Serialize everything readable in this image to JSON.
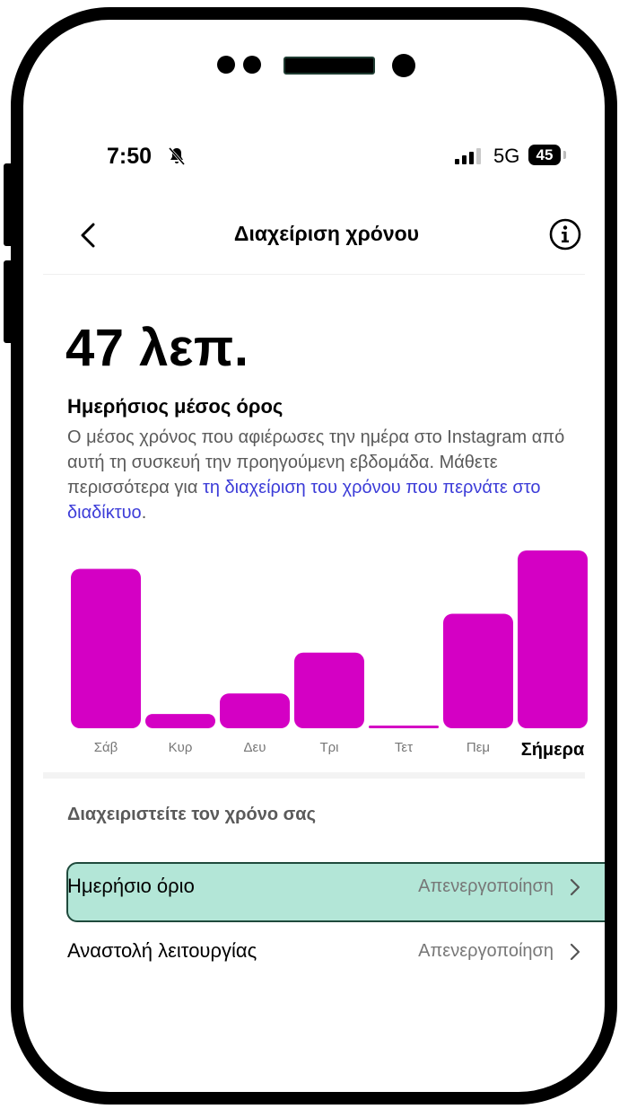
{
  "status_bar": {
    "time": "7:50",
    "network": "5G",
    "battery": "45",
    "bell_icon": "bell-slash-icon",
    "signal_icon": "cellular-signal-icon"
  },
  "header": {
    "title": "Διαχείριση χρόνου",
    "back_icon": "back-chevron-icon",
    "info_icon": "info-circle-icon"
  },
  "summary": {
    "value": "47 λεπ.",
    "label": "Ημερήσιος μέσος όρος",
    "description_text": "Ο μέσος χρόνος που αφιέρωσες την ημέρα στο Instagram από αυτή τη συσκευή την προηγούμενη εβδομάδα. Μάθετε περισσότερα για ",
    "description_link": "τη διαχείριση του χρόνου που περνάτε στο διαδίκτυο",
    "description_end": "."
  },
  "chart_data": {
    "type": "bar",
    "categories": [
      "Σάβ",
      "Κυρ",
      "Δευ",
      "Τρι",
      "Τετ",
      "Πεμ",
      "Σήμερα"
    ],
    "values": [
      78,
      7,
      17,
      37,
      1,
      56,
      87
    ],
    "highlight_category": "Σήμερα",
    "color": "#d400c4",
    "ylim": [
      0,
      87
    ]
  },
  "manage": {
    "section_title": "Διαχειριστείτε τον χρόνο σας",
    "rows": [
      {
        "label": "Ημερήσιο όριο",
        "value": "Απενεργοποίηση"
      },
      {
        "label": "Αναστολή λειτουργίας",
        "value": "Απενεργοποίηση"
      }
    ],
    "chevron_icon": "chevron-right-icon"
  },
  "colors": {
    "accent_bar": "#d400c4",
    "link": "#3c3cd8",
    "highlight": "#a8e0d0"
  }
}
